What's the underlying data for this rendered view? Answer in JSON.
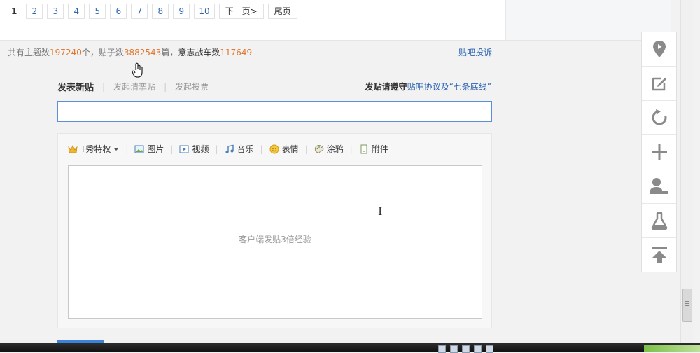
{
  "pager": {
    "pages": [
      "1",
      "2",
      "3",
      "4",
      "5",
      "6",
      "7",
      "8",
      "9",
      "10"
    ],
    "next_label": "下一页>",
    "last_label": "尾页"
  },
  "stats": {
    "prefix": "共有主题数",
    "topics": "197240",
    "mid1": "个，贴子数",
    "posts": "3882543",
    "mid2": "篇，",
    "members_label": "意志战车数",
    "members": "117649"
  },
  "report_label": "贴吧投诉",
  "tabs": {
    "new_post": "发表新贴",
    "raffle": "发起清挛贴",
    "vote": "发起投票"
  },
  "notice": {
    "prefix": "发贴请遵守",
    "link": "贴吧协议及“七条底线”"
  },
  "toolbar": {
    "tshow": "T秀特权",
    "image": "图片",
    "video": "视频",
    "music": "音乐",
    "emoji": "表情",
    "doodle": "涂鸦",
    "attach": "附件"
  },
  "editor": {
    "placeholder": "客户端发贴3倍经验"
  },
  "colors": {
    "link": "#2d64b3",
    "stat_number": "#e0762e",
    "input_border": "#5b90d9"
  },
  "sidebar_icons": [
    "location-icon",
    "edit-icon",
    "refresh-icon",
    "plus-icon",
    "member-icon",
    "flask-icon",
    "back-to-top-icon"
  ]
}
